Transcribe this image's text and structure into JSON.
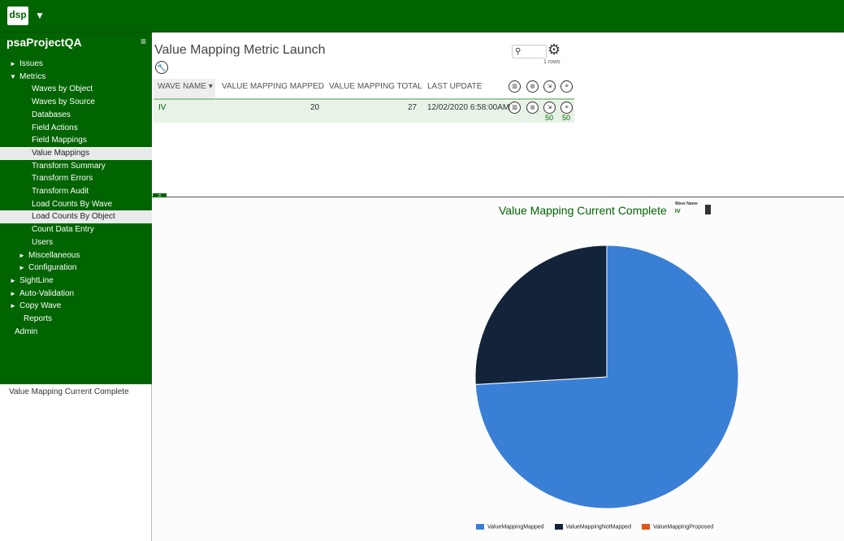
{
  "app": {
    "logo": "dsp",
    "project": "psaProjectQA"
  },
  "nav": [
    {
      "label": "Issues",
      "arrow": "►",
      "indent": 0
    },
    {
      "label": "Metrics",
      "arrow": "▼",
      "indent": 0
    },
    {
      "label": "Waves by Object",
      "arrow": "",
      "indent": 1
    },
    {
      "label": "Waves by Source",
      "arrow": "",
      "indent": 1
    },
    {
      "label": "Databases",
      "arrow": "",
      "indent": 1
    },
    {
      "label": "Field Actions",
      "arrow": "",
      "indent": 1
    },
    {
      "label": "Field Mappings",
      "arrow": "",
      "indent": 1
    },
    {
      "label": "Value Mappings",
      "arrow": "",
      "indent": 1,
      "selected": true
    },
    {
      "label": "Transform Summary",
      "arrow": "",
      "indent": 1
    },
    {
      "label": "Transform Errors",
      "arrow": "",
      "indent": 1
    },
    {
      "label": "Transform Audit",
      "arrow": "",
      "indent": 1
    },
    {
      "label": "Load Counts By Wave",
      "arrow": "",
      "indent": 1
    },
    {
      "label": "Load Counts By Object",
      "arrow": "",
      "indent": 1,
      "selected": true
    },
    {
      "label": "Count Data Entry",
      "arrow": "",
      "indent": 1
    },
    {
      "label": "Users",
      "arrow": "",
      "indent": 1
    },
    {
      "label": "Miscellaneous",
      "arrow": "►",
      "indent": 2
    },
    {
      "label": "Configuration",
      "arrow": "►",
      "indent": 2
    },
    {
      "label": "SightLine",
      "arrow": "►",
      "indent": 0
    },
    {
      "label": "Auto-Validation",
      "arrow": "►",
      "indent": 0
    },
    {
      "label": "Copy Wave",
      "arrow": "►",
      "indent": 0
    },
    {
      "label": "Reports",
      "arrow": "",
      "indent": 3
    },
    {
      "label": "Admin",
      "arrow": "",
      "indent": 4
    }
  ],
  "sidebar_footer": "Value Mapping Current Complete",
  "page": {
    "title": "Value Mapping Metric Launch",
    "rows_text": "1 rows"
  },
  "table": {
    "headers": [
      "WAVE NAME ▾",
      "VALUE MAPPING MAPPED",
      "VALUE MAPPING TOTAL",
      "LAST UPDATE"
    ],
    "row": {
      "wave": "IV",
      "mapped": "20",
      "total": "27",
      "last_update": "12/02/2020 6:58:00AM",
      "count_a": "50",
      "count_b": "50"
    }
  },
  "chart": {
    "title": "Value Mapping Current Complete",
    "filter_label": "Wave Name",
    "filter_value": "IV"
  },
  "chart_data": {
    "type": "pie",
    "series": [
      {
        "name": "ValueMappingMapped",
        "value": 20,
        "color": "#3a7fd6"
      },
      {
        "name": "ValueMappingNotMapped",
        "value": 7,
        "color": "#13243a"
      },
      {
        "name": "ValueMappingProposed",
        "value": 0,
        "color": "#e0541d"
      }
    ],
    "legend_position": "bottom"
  }
}
